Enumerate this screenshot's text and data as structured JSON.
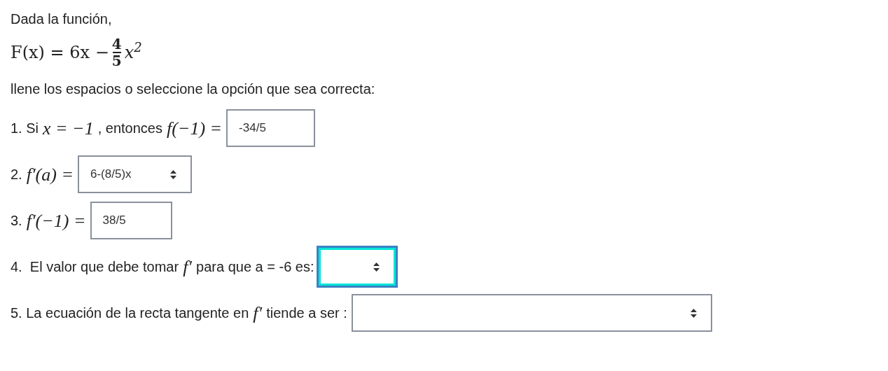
{
  "intro": "Dada la función,",
  "formula": {
    "lead": "F(x) = 6x −",
    "numerator": "4",
    "denominator": "5",
    "tail": "x$^{2}$"
  },
  "instruction": "llene los espacios o seleccione la opción que sea correcta:",
  "questions": [
    {
      "parts": [
        {
          "kind": "text",
          "text": "1. Si"
        },
        {
          "kind": "math",
          "text": "x = −1"
        },
        {
          "kind": "text",
          "text": ", entonces"
        },
        {
          "kind": "math",
          "text": "f(−1) ="
        }
      ],
      "answer": {
        "kind": "input",
        "value": "-34/5",
        "focused": false
      }
    },
    {
      "parts": [
        {
          "kind": "text",
          "text": "2."
        },
        {
          "kind": "math",
          "text": "f′(a) ="
        }
      ],
      "answer": {
        "kind": "select",
        "value": "6-(8/5)x",
        "focused": false
      }
    },
    {
      "parts": [
        {
          "kind": "text",
          "text": "3."
        },
        {
          "kind": "math",
          "text": "f′(−1) ="
        }
      ],
      "answer": {
        "kind": "input",
        "value": "38/5",
        "focused": false
      }
    },
    {
      "parts": [
        {
          "kind": "text",
          "text": "4.  El valor que debe tomar"
        },
        {
          "kind": "math",
          "text": "f′"
        },
        {
          "kind": "text",
          "text": "para que a = -6 es:"
        }
      ],
      "answer": {
        "kind": "select",
        "focused": true
      }
    },
    {
      "parts": [
        {
          "kind": "text",
          "text": "5. La ecuación de la recta tangente en"
        },
        {
          "kind": "math",
          "text": "f′"
        },
        {
          "kind": "text",
          "text": "tiende a ser :"
        }
      ],
      "answer": {
        "kind": "select",
        "focused": false
      }
    }
  ]
}
